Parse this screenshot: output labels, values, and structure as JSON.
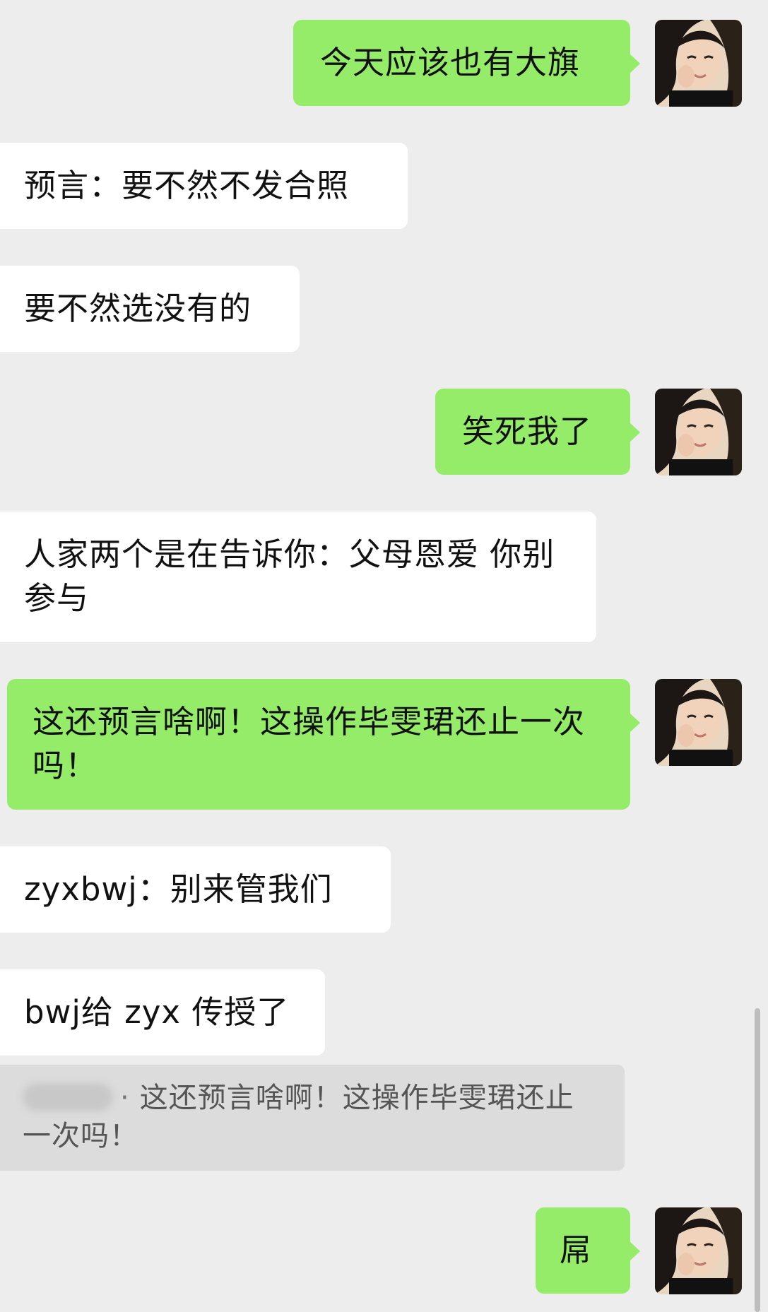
{
  "messages": [
    {
      "side": "right",
      "text": "今天应该也有大旗"
    },
    {
      "side": "left",
      "text": "预言：要不然不发合照"
    },
    {
      "side": "left",
      "text": "要不然选没有的"
    },
    {
      "side": "right",
      "text": "笑死我了"
    },
    {
      "side": "left",
      "text": "人家两个是在告诉你：父母恩爱 你别参与"
    },
    {
      "side": "right",
      "text": "这还预言啥啊！这操作毕雯珺还止一次吗！"
    },
    {
      "side": "left",
      "text": "zyxbwj：别来管我们"
    },
    {
      "side": "left",
      "text": "bwj给 zyx 传授了"
    },
    {
      "side": "right",
      "text": "屌"
    }
  ],
  "quote": {
    "separator": "·",
    "text": "这还预言啥啊！这操作毕雯珺还止一次吗！"
  },
  "avatar": {
    "icon": "girl-avatar",
    "colors": {
      "skin": "#f1d3bb",
      "hair": "#1c1714",
      "bg": "#e9d6c0"
    }
  },
  "colors": {
    "background": "#ededed",
    "bubble_self": "#95ec69",
    "bubble_other": "#ffffff",
    "quote_bg": "#dcdcdc"
  }
}
